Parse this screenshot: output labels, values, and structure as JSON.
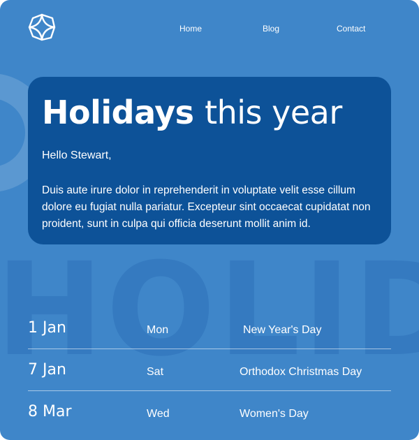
{
  "nav": {
    "items": [
      {
        "label": "Home"
      },
      {
        "label": "Blog"
      },
      {
        "label": "Contact"
      }
    ]
  },
  "hero": {
    "background_word": "HOLIDAYS",
    "title_bold": "Holidays",
    "title_light": "this year",
    "greeting": "Hello Stewart,",
    "body": "Duis aute irure dolor in reprehenderit in voluptate velit esse cillum dolore eu fugiat nulla pariatur. Excepteur sint occaecat cupidatat non proident, sunt in culpa qui officia deserunt mollit anim id."
  },
  "holidays": [
    {
      "date": "1 Jan",
      "day": "Mon",
      "name": "New Year's Day"
    },
    {
      "date": "7 Jan",
      "day": "Sat",
      "name": "Orthodox Christmas Day"
    },
    {
      "date": "8 Mar",
      "day": "Wed",
      "name": "Women's Day"
    }
  ],
  "colors": {
    "background": "#3f86c9",
    "card": "#0d5298",
    "text": "#ffffff"
  }
}
